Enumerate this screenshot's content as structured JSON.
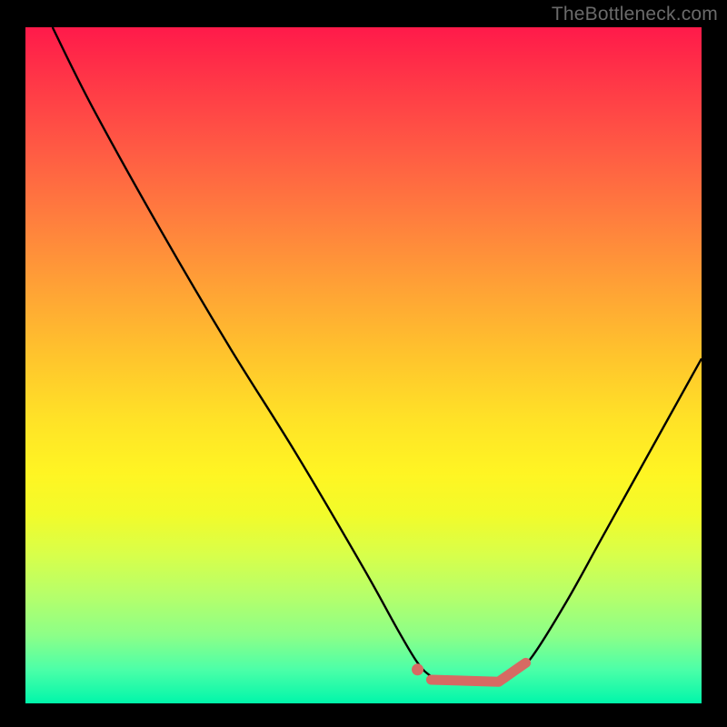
{
  "attribution": "TheBottleneck.com",
  "colors": {
    "background": "#000000",
    "gradient_top": "#ff1a4a",
    "gradient_bottom": "#00f6aa",
    "curve": "#000000",
    "marker": "#d66a63",
    "marker_stroke": "#c05a55"
  },
  "chart_data": {
    "type": "line",
    "title": "",
    "xlabel": "",
    "ylabel": "",
    "xlim": [
      0,
      100
    ],
    "ylim": [
      0,
      100
    ],
    "series": [
      {
        "name": "bottleneck-curve",
        "x": [
          4,
          10,
          20,
          30,
          40,
          50,
          55,
          58,
          60,
          62,
          65,
          70,
          72,
          75,
          80,
          85,
          90,
          95,
          100
        ],
        "y": [
          100,
          88,
          70,
          53,
          37,
          20,
          11,
          6,
          4,
          3,
          3,
          3,
          4,
          7,
          15,
          24,
          33,
          42,
          51
        ]
      }
    ],
    "markers": {
      "dot": {
        "x": 58,
        "y": 5
      },
      "segment_start": {
        "x": 60,
        "y": 3.5
      },
      "segment_mid": {
        "x": 70,
        "y": 3.2
      },
      "segment_end": {
        "x": 74,
        "y": 6
      }
    }
  }
}
